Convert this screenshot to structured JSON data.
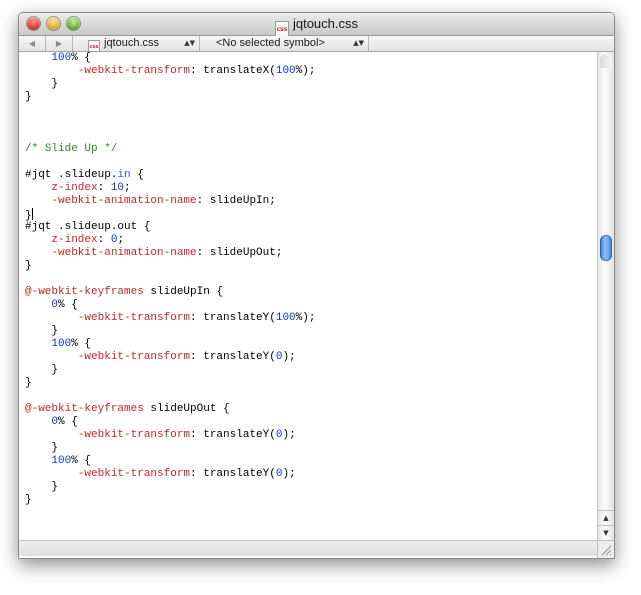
{
  "window": {
    "title": "jqtouch.css",
    "file_icon_label": "css"
  },
  "navbar": {
    "back_arrow": "◀",
    "forward_arrow": "▶",
    "file_popup_label": "jqtouch.css",
    "symbol_popup_label": "<No selected symbol>",
    "popup_arrows": "▲▼"
  },
  "scrollbar": {
    "up_arrow": "▲",
    "down_arrow": "▼",
    "thumb_position_fraction": 0.4
  },
  "colors": {
    "property": "#c0282b",
    "number": "#1a2fd8",
    "comment": "#2e8a26",
    "keyword": "#3a57d6",
    "scroll_thumb": "#4a8ae0"
  },
  "code_lines": [
    [
      {
        "t": "    "
      },
      {
        "t": "100",
        "c": "num"
      },
      {
        "t": "% {"
      }
    ],
    [
      {
        "t": "        "
      },
      {
        "t": "-webkit-transform",
        "c": "prop"
      },
      {
        "t": ": translateX("
      },
      {
        "t": "100",
        "c": "num"
      },
      {
        "t": "%);"
      }
    ],
    [
      {
        "t": "    }"
      }
    ],
    [
      {
        "t": "}"
      }
    ],
    [],
    [],
    [],
    [
      {
        "t": "/* Slide Up */",
        "c": "comment"
      }
    ],
    [],
    [
      {
        "t": "#jqt .slideup."
      },
      {
        "t": "in",
        "c": "kw"
      },
      {
        "t": " {"
      }
    ],
    [
      {
        "t": "    "
      },
      {
        "t": "z-index",
        "c": "prop"
      },
      {
        "t": ": "
      },
      {
        "t": "10",
        "c": "num"
      },
      {
        "t": ";"
      }
    ],
    [
      {
        "t": "    "
      },
      {
        "t": "-webkit-animation-name",
        "c": "prop"
      },
      {
        "t": ": slideUpIn;"
      }
    ],
    [
      {
        "t": "}",
        "cursor": true
      }
    ],
    [
      {
        "t": "#jqt .slideup.out {"
      }
    ],
    [
      {
        "t": "    "
      },
      {
        "t": "z-index",
        "c": "prop"
      },
      {
        "t": ": "
      },
      {
        "t": "0",
        "c": "num"
      },
      {
        "t": ";"
      }
    ],
    [
      {
        "t": "    "
      },
      {
        "t": "-webkit-animation-name",
        "c": "prop"
      },
      {
        "t": ": slideUpOut;"
      }
    ],
    [
      {
        "t": "}"
      }
    ],
    [],
    [
      {
        "t": "@-webkit-keyframes",
        "c": "at"
      },
      {
        "t": " slideUpIn {"
      }
    ],
    [
      {
        "t": "    "
      },
      {
        "t": "0",
        "c": "num"
      },
      {
        "t": "% {"
      }
    ],
    [
      {
        "t": "        "
      },
      {
        "t": "-webkit-transform",
        "c": "prop"
      },
      {
        "t": ": translateY("
      },
      {
        "t": "100",
        "c": "num"
      },
      {
        "t": "%);"
      }
    ],
    [
      {
        "t": "    }"
      }
    ],
    [
      {
        "t": "    "
      },
      {
        "t": "100",
        "c": "num"
      },
      {
        "t": "% {"
      }
    ],
    [
      {
        "t": "        "
      },
      {
        "t": "-webkit-transform",
        "c": "prop"
      },
      {
        "t": ": translateY("
      },
      {
        "t": "0",
        "c": "num"
      },
      {
        "t": ");"
      }
    ],
    [
      {
        "t": "    }"
      }
    ],
    [
      {
        "t": "}"
      }
    ],
    [],
    [
      {
        "t": "@-webkit-keyframes",
        "c": "at"
      },
      {
        "t": " slideUpOut {"
      }
    ],
    [
      {
        "t": "    "
      },
      {
        "t": "0",
        "c": "num"
      },
      {
        "t": "% {"
      }
    ],
    [
      {
        "t": "        "
      },
      {
        "t": "-webkit-transform",
        "c": "prop"
      },
      {
        "t": ": translateY("
      },
      {
        "t": "0",
        "c": "num"
      },
      {
        "t": ");"
      }
    ],
    [
      {
        "t": "    }"
      }
    ],
    [
      {
        "t": "    "
      },
      {
        "t": "100",
        "c": "num"
      },
      {
        "t": "% {"
      }
    ],
    [
      {
        "t": "        "
      },
      {
        "t": "-webkit-transform",
        "c": "prop"
      },
      {
        "t": ": translateY("
      },
      {
        "t": "0",
        "c": "num"
      },
      {
        "t": ");"
      }
    ],
    [
      {
        "t": "    }"
      }
    ],
    [
      {
        "t": "}"
      }
    ]
  ]
}
